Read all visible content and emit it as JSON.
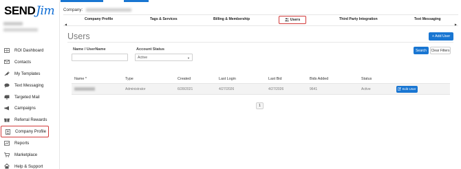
{
  "brand": {
    "name_part1": "SEND",
    "name_part2": "Jim"
  },
  "sidebar": {
    "items": [
      {
        "label": "ROI Dashboard",
        "icon": "grid-icon"
      },
      {
        "label": "Contacts",
        "icon": "envelope-icon"
      },
      {
        "label": "My Templates",
        "icon": "plug-icon"
      },
      {
        "label": "Text Messaging",
        "icon": "chat-icon"
      },
      {
        "label": "Targeted Mail",
        "icon": "mailbox-icon"
      },
      {
        "label": "Campaigns",
        "icon": "megaphone-icon"
      },
      {
        "label": "Referral Rewards",
        "icon": "gift-icon"
      },
      {
        "label": "Company Profile",
        "icon": "profile-icon",
        "active": true
      },
      {
        "label": "Reports",
        "icon": "chart-icon"
      },
      {
        "label": "Marketplace",
        "icon": "cart-icon"
      },
      {
        "label": "Help & Support",
        "icon": "help-icon"
      }
    ]
  },
  "header": {
    "company_label": "Company:"
  },
  "tabs": [
    {
      "label": "Company Profile"
    },
    {
      "label": "Tags & Services"
    },
    {
      "label": "Billing & Membership"
    },
    {
      "label": "Users",
      "active": true
    },
    {
      "label": "Third Party Integration"
    },
    {
      "label": "Text Messaging"
    }
  ],
  "page": {
    "title": "Users",
    "add_user_label": "+ Add User"
  },
  "filters": {
    "name_label": "Name / UserName",
    "name_value": "",
    "status_label": "Account Status",
    "status_value": "Active",
    "search_label": "Search",
    "clear_label": "Clear Filters"
  },
  "table": {
    "columns": [
      "Name *",
      "Type",
      "Created",
      "Last Login",
      "Last Bid",
      "Bids Added",
      "Status"
    ],
    "rows": [
      {
        "type": "Administrator",
        "created": "6/28/2021",
        "last_login": "4/27/2026",
        "last_bid": "4/27/2026",
        "bids_added": "9641",
        "status": "Active",
        "action_label": "Edit User"
      }
    ]
  },
  "pagination": {
    "current_page": "1"
  },
  "colors": {
    "accent": "#1976d2",
    "highlight": "#d23a3a"
  }
}
